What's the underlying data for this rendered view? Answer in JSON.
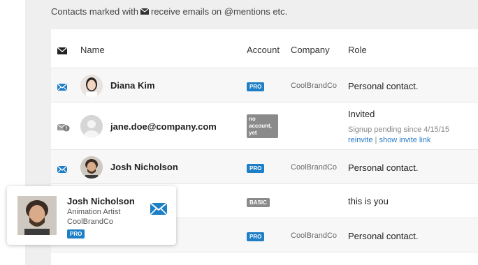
{
  "note": {
    "prefix": "Contacts marked with",
    "suffix": "receive emails on @mentions etc."
  },
  "table": {
    "headers": {
      "name": "Name",
      "account": "Account",
      "company": "Company",
      "role": "Role"
    },
    "rows": [
      {
        "name": "Diana Kim",
        "account": "PRO",
        "company": "CoolBrandCo",
        "role": "Personal contact."
      },
      {
        "name": "jane.doe@company.com",
        "account_line1": "no",
        "account_line2": "account,",
        "account_line3": "yet",
        "role": "Invited",
        "status": "Signup pending since 4/15/15",
        "reinvite": "reinvite",
        "separator": "|",
        "show_invite": "show invite link"
      },
      {
        "name": "Josh Nicholson",
        "account": "PRO",
        "company": "CoolBrandCo",
        "role": "Personal contact."
      },
      {
        "account": "BASIC",
        "role": "this is you"
      },
      {
        "account": "PRO",
        "company": "CoolBrandCo",
        "role": "Personal contact."
      }
    ]
  },
  "popup": {
    "name": "Josh Nicholson",
    "title": "Animation Artist",
    "company": "CoolBrandCo",
    "badge": "PRO"
  },
  "colors": {
    "accent": "#1e7fc7",
    "badge_gray": "#8a8a8a",
    "link": "#2a7cc7"
  }
}
